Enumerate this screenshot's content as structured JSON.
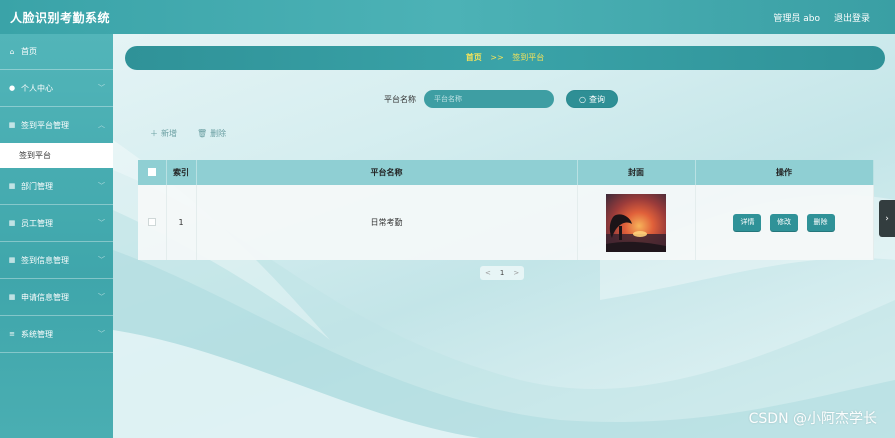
{
  "app": {
    "title": "人脸识别考勤系统"
  },
  "topbar": {
    "user_label": "管理员 abo",
    "logout_label": "退出登录"
  },
  "sidebar": {
    "items": [
      {
        "label": "首页",
        "icon": "home-icon"
      },
      {
        "label": "个人中心",
        "icon": "user-icon"
      },
      {
        "label": "签到平台管理",
        "icon": "grid-icon"
      },
      {
        "label": "部门管理",
        "icon": "grid-icon"
      },
      {
        "label": "员工管理",
        "icon": "grid-icon"
      },
      {
        "label": "签到信息管理",
        "icon": "grid-icon"
      },
      {
        "label": "申请信息管理",
        "icon": "grid-icon"
      },
      {
        "label": "系统管理",
        "icon": "list-icon"
      }
    ],
    "subitem": {
      "label": "签到平台"
    }
  },
  "breadcrumb": {
    "home": "首页",
    "separator": ">>",
    "current": "签到平台"
  },
  "search": {
    "label": "平台名称",
    "placeholder": "平台名称",
    "button_label": "查询"
  },
  "actions": {
    "add_label": "新增",
    "delete_label": "删除"
  },
  "table": {
    "headers": {
      "index": "索引",
      "name": "平台名称",
      "cover": "封面",
      "ops": "操作"
    },
    "rows": [
      {
        "index": "1",
        "name": "日常考勤",
        "ops": {
          "detail": "详情",
          "edit": "修改",
          "delete": "删除"
        }
      }
    ]
  },
  "pager": {
    "prev": "<",
    "page": "1",
    "next": ">"
  },
  "watermark": "CSDN @小阿杰学长",
  "colors": {
    "accent": "#3aa3a8",
    "dark_accent": "#2f9298",
    "header": "#8fcfd3",
    "crumb_text": "#f5e35a"
  }
}
